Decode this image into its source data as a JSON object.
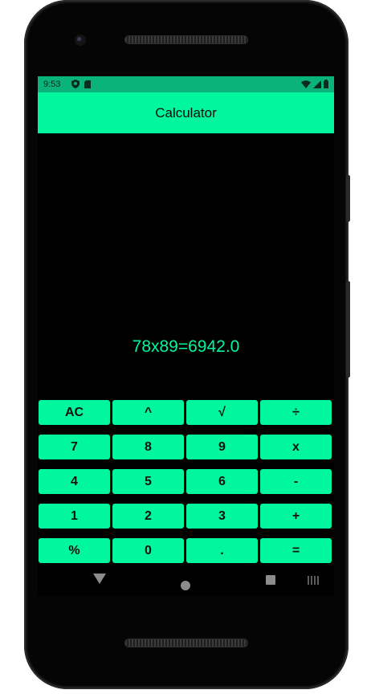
{
  "status_bar": {
    "time": "9:53",
    "icons_left": [
      "shield-icon",
      "sd-card-icon"
    ],
    "icons_right": [
      "wifi-icon",
      "signal-icon",
      "battery-icon"
    ],
    "color": "#0ab37a"
  },
  "app_bar": {
    "title": "Calculator",
    "color": "#00f79e"
  },
  "display": {
    "expression": "78x89=6942.0",
    "color": "#00f79e"
  },
  "keypad": {
    "rows": [
      [
        "AC",
        "^",
        "√",
        "÷"
      ],
      [
        "7",
        "8",
        "9",
        "x"
      ],
      [
        "4",
        "5",
        "6",
        "-"
      ],
      [
        "1",
        "2",
        "3",
        "+"
      ],
      [
        "%",
        "0",
        ".",
        "="
      ]
    ],
    "key_color": "#00f79e"
  },
  "nav_bar": {
    "buttons": [
      "back-icon",
      "home-icon",
      "recents-icon",
      "keyboard-icon"
    ]
  }
}
